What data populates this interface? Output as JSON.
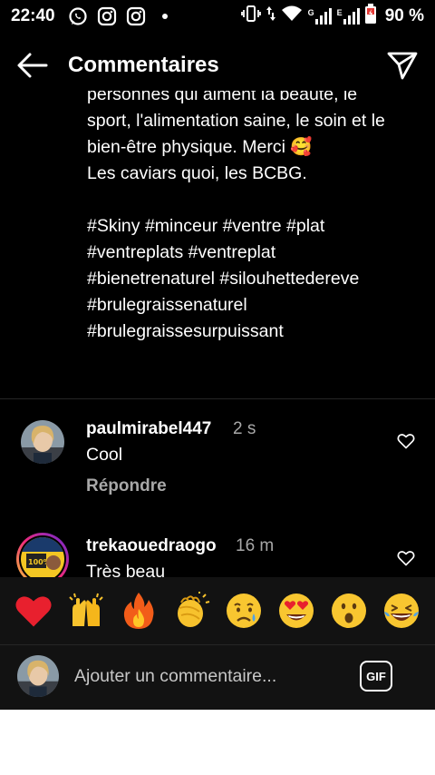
{
  "status_bar": {
    "time": "22:40",
    "battery": "90 %",
    "network_type": "G",
    "network_type_2": "E",
    "icons": [
      "whatsapp-icon",
      "instagram-icon",
      "instagram-icon",
      "notification-dot",
      "vibrate-icon",
      "data-arrows-icon",
      "wifi-icon",
      "signal-icon",
      "signal-icon",
      "battery-icon"
    ]
  },
  "header": {
    "title": "Commentaires",
    "back_icon": "arrow-left-icon",
    "share_icon": "paper-plane-icon"
  },
  "caption": {
    "text": "personnes qui aiment la beauté, le sport, l'alimentation saine, le soin et le bien-être physique. Merci 🥰\nLes caviars quoi, les BCBG.\n\n#Skiny #minceur #ventre #plat #ventreplats #ventreplat #bienetrenaturel #silouhettedereve #brulegraissenaturel #brulegraissesurpuissant"
  },
  "comments": [
    {
      "username": "paulmirabel447",
      "time": "2 s",
      "text": "Cool",
      "reply_label": "Répondre"
    },
    {
      "username": "trekaouedraogo",
      "time": "16 m",
      "text": "Très beau",
      "avatar_text": "100%"
    }
  ],
  "emoji_bar": [
    "❤️",
    "🙌",
    "🔥",
    "👏",
    "😢",
    "😍",
    "😮",
    "😂"
  ],
  "composer": {
    "placeholder": "Ajouter un commentaire...",
    "gif_label": "GIF"
  },
  "colors": {
    "background": "#000000",
    "panel": "#121212",
    "secondary_text": "#a8a8a8",
    "divider": "#262626"
  }
}
